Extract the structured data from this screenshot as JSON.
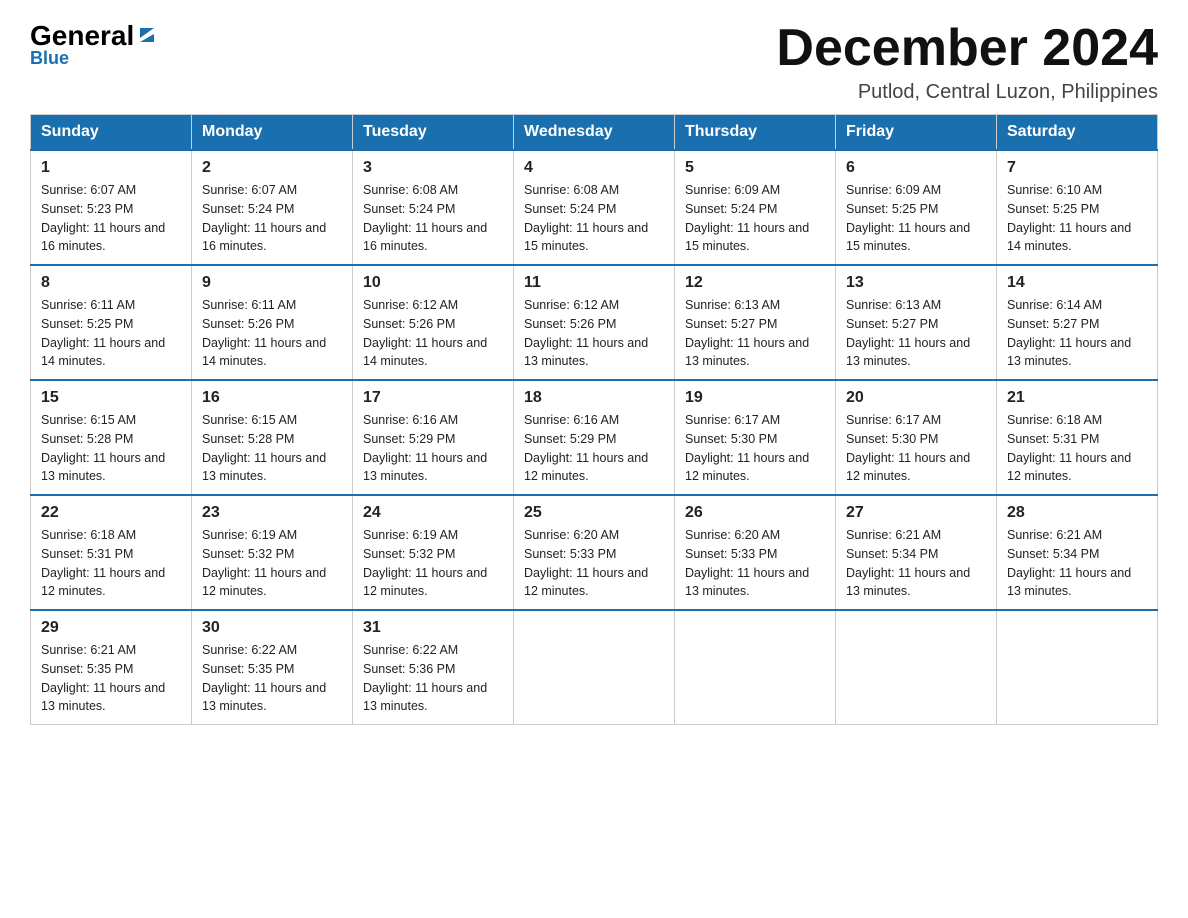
{
  "logo": {
    "general": "General",
    "blue": "Blue",
    "triangle": "▶"
  },
  "header": {
    "month_title": "December 2024",
    "subtitle": "Putlod, Central Luzon, Philippines"
  },
  "weekdays": [
    "Sunday",
    "Monday",
    "Tuesday",
    "Wednesday",
    "Thursday",
    "Friday",
    "Saturday"
  ],
  "weeks": [
    [
      {
        "day": "1",
        "sunrise": "6:07 AM",
        "sunset": "5:23 PM",
        "daylight": "11 hours and 16 minutes."
      },
      {
        "day": "2",
        "sunrise": "6:07 AM",
        "sunset": "5:24 PM",
        "daylight": "11 hours and 16 minutes."
      },
      {
        "day": "3",
        "sunrise": "6:08 AM",
        "sunset": "5:24 PM",
        "daylight": "11 hours and 16 minutes."
      },
      {
        "day": "4",
        "sunrise": "6:08 AM",
        "sunset": "5:24 PM",
        "daylight": "11 hours and 15 minutes."
      },
      {
        "day": "5",
        "sunrise": "6:09 AM",
        "sunset": "5:24 PM",
        "daylight": "11 hours and 15 minutes."
      },
      {
        "day": "6",
        "sunrise": "6:09 AM",
        "sunset": "5:25 PM",
        "daylight": "11 hours and 15 minutes."
      },
      {
        "day": "7",
        "sunrise": "6:10 AM",
        "sunset": "5:25 PM",
        "daylight": "11 hours and 14 minutes."
      }
    ],
    [
      {
        "day": "8",
        "sunrise": "6:11 AM",
        "sunset": "5:25 PM",
        "daylight": "11 hours and 14 minutes."
      },
      {
        "day": "9",
        "sunrise": "6:11 AM",
        "sunset": "5:26 PM",
        "daylight": "11 hours and 14 minutes."
      },
      {
        "day": "10",
        "sunrise": "6:12 AM",
        "sunset": "5:26 PM",
        "daylight": "11 hours and 14 minutes."
      },
      {
        "day": "11",
        "sunrise": "6:12 AM",
        "sunset": "5:26 PM",
        "daylight": "11 hours and 13 minutes."
      },
      {
        "day": "12",
        "sunrise": "6:13 AM",
        "sunset": "5:27 PM",
        "daylight": "11 hours and 13 minutes."
      },
      {
        "day": "13",
        "sunrise": "6:13 AM",
        "sunset": "5:27 PM",
        "daylight": "11 hours and 13 minutes."
      },
      {
        "day": "14",
        "sunrise": "6:14 AM",
        "sunset": "5:27 PM",
        "daylight": "11 hours and 13 minutes."
      }
    ],
    [
      {
        "day": "15",
        "sunrise": "6:15 AM",
        "sunset": "5:28 PM",
        "daylight": "11 hours and 13 minutes."
      },
      {
        "day": "16",
        "sunrise": "6:15 AM",
        "sunset": "5:28 PM",
        "daylight": "11 hours and 13 minutes."
      },
      {
        "day": "17",
        "sunrise": "6:16 AM",
        "sunset": "5:29 PM",
        "daylight": "11 hours and 13 minutes."
      },
      {
        "day": "18",
        "sunrise": "6:16 AM",
        "sunset": "5:29 PM",
        "daylight": "11 hours and 12 minutes."
      },
      {
        "day": "19",
        "sunrise": "6:17 AM",
        "sunset": "5:30 PM",
        "daylight": "11 hours and 12 minutes."
      },
      {
        "day": "20",
        "sunrise": "6:17 AM",
        "sunset": "5:30 PM",
        "daylight": "11 hours and 12 minutes."
      },
      {
        "day": "21",
        "sunrise": "6:18 AM",
        "sunset": "5:31 PM",
        "daylight": "11 hours and 12 minutes."
      }
    ],
    [
      {
        "day": "22",
        "sunrise": "6:18 AM",
        "sunset": "5:31 PM",
        "daylight": "11 hours and 12 minutes."
      },
      {
        "day": "23",
        "sunrise": "6:19 AM",
        "sunset": "5:32 PM",
        "daylight": "11 hours and 12 minutes."
      },
      {
        "day": "24",
        "sunrise": "6:19 AM",
        "sunset": "5:32 PM",
        "daylight": "11 hours and 12 minutes."
      },
      {
        "day": "25",
        "sunrise": "6:20 AM",
        "sunset": "5:33 PM",
        "daylight": "11 hours and 12 minutes."
      },
      {
        "day": "26",
        "sunrise": "6:20 AM",
        "sunset": "5:33 PM",
        "daylight": "11 hours and 13 minutes."
      },
      {
        "day": "27",
        "sunrise": "6:21 AM",
        "sunset": "5:34 PM",
        "daylight": "11 hours and 13 minutes."
      },
      {
        "day": "28",
        "sunrise": "6:21 AM",
        "sunset": "5:34 PM",
        "daylight": "11 hours and 13 minutes."
      }
    ],
    [
      {
        "day": "29",
        "sunrise": "6:21 AM",
        "sunset": "5:35 PM",
        "daylight": "11 hours and 13 minutes."
      },
      {
        "day": "30",
        "sunrise": "6:22 AM",
        "sunset": "5:35 PM",
        "daylight": "11 hours and 13 minutes."
      },
      {
        "day": "31",
        "sunrise": "6:22 AM",
        "sunset": "5:36 PM",
        "daylight": "11 hours and 13 minutes."
      },
      null,
      null,
      null,
      null
    ]
  ]
}
